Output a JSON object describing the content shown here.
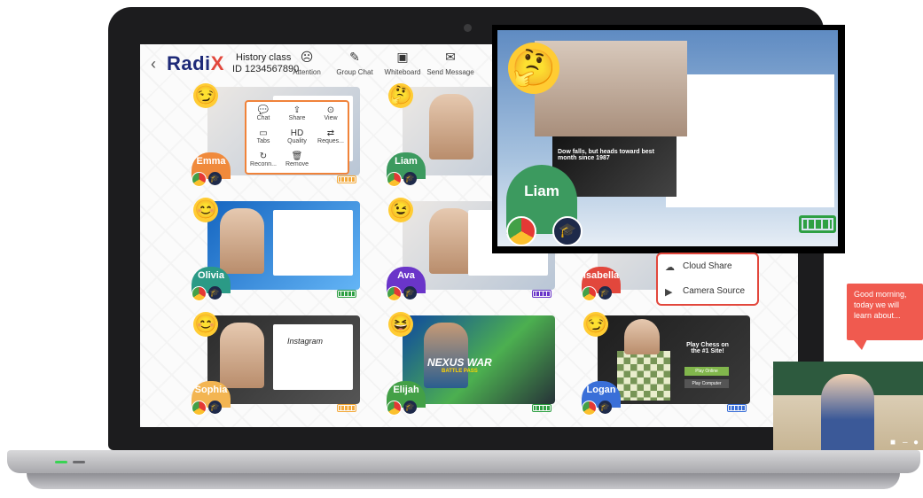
{
  "header": {
    "back_icon": "back-arrow-icon",
    "logo_text": "Radi",
    "logo_x": "X",
    "class_name": "History class",
    "class_id": "ID 1234567890",
    "tools": [
      {
        "label": "Attention",
        "icon": "attention-icon"
      },
      {
        "label": "Group Chat",
        "icon": "group-chat-icon"
      },
      {
        "label": "Whiteboard",
        "icon": "whiteboard-icon"
      },
      {
        "label": "Send Message",
        "icon": "send-message-icon"
      }
    ]
  },
  "student_menu": {
    "items": [
      "Chat",
      "Share",
      "View",
      "Tabs",
      "Quality",
      "Reques...",
      "Reconn...",
      "Remove"
    ]
  },
  "students": [
    {
      "name": "Emma",
      "color": "#f08a3c",
      "battery_color": "#f3a93b"
    },
    {
      "name": "Liam",
      "color": "#3c9a5f",
      "battery_color": "#f3a93b"
    },
    {
      "name": "Olivia",
      "color": "#2b9a86",
      "battery_color": "#2ea043"
    },
    {
      "name": "Ava",
      "color": "#6a35c9",
      "battery_color": "#6a35c9"
    },
    {
      "name": "Isabella",
      "color": "#e2473c",
      "battery_color": "#e2473c"
    },
    {
      "name": "Sophia",
      "color": "#f3b552",
      "battery_color": "#f3a93b"
    },
    {
      "name": "Elijah",
      "color": "#43a047",
      "battery_color": "#2ea043"
    },
    {
      "name": "Logan",
      "color": "#3a6fd8",
      "battery_color": "#3a6fd8"
    }
  ],
  "screens": {
    "instagram": "Instagram",
    "game_title": "NEXUS WAR",
    "game_sub": "BATTLE PASS",
    "chess_title": "Play Chess on the #1 Site!",
    "chess_btn1": "Play Online",
    "chess_btn2": "Play Computer"
  },
  "zoom": {
    "name": "Liam",
    "headline": "Dow falls, but heads toward best month since 1987"
  },
  "context_menu": {
    "items": [
      "Cloud Share",
      "Camera Source"
    ]
  },
  "teacher": {
    "message": "Good morning, today we will learn about..."
  }
}
